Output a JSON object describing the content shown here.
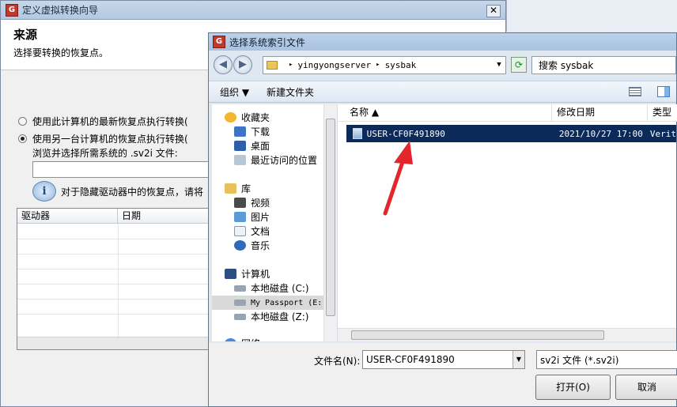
{
  "wizard": {
    "logo_text": "G",
    "title": "定义虚拟转换向导",
    "close_symbol": "✕",
    "header_title": "来源",
    "header_subtitle": "选择要转换的恢复点。",
    "option1": "使用此计算机的最新恢复点执行转换(",
    "option2": "使用另一台计算机的恢复点执行转换(",
    "browse_label": "浏览并选择所需系统的 .sv2i 文件:",
    "info_glyph": "i",
    "info_text": "对于隐藏驱动器中的恢复点，请将",
    "table_headers": [
      "驱动器",
      "日期"
    ]
  },
  "dialog": {
    "logo_text": "G",
    "title": "选择系统索引文件",
    "back_symbol": "◀",
    "forward_symbol": "▶",
    "breadcrumb": [
      "yingyongserver",
      "sysbak"
    ],
    "crumb_separator": "▸",
    "address_dropdown": "▼",
    "refresh_symbol": "⟳",
    "search_placeholder": "搜索 sysbak",
    "toolbar": {
      "organize": "组织 ▼",
      "new_folder": "新建文件夹"
    },
    "nav": {
      "favorites": "收藏夹",
      "downloads": "下载",
      "desktop": "桌面",
      "recent": "最近访问的位置",
      "libraries": "库",
      "videos": "视频",
      "pictures": "图片",
      "documents": "文档",
      "music": "音乐",
      "computer": "计算机",
      "drive_c": "本地磁盘 (C:)",
      "passport": "My Passport (E:",
      "drive_z": "本地磁盘 (Z:)",
      "network": "网络"
    },
    "columns": {
      "name": "名称 ▲",
      "date": "修改日期",
      "type": "类型"
    },
    "file": {
      "name": "USER-CF0F491890",
      "date": "2021/10/27 17:00",
      "type": "Verit"
    },
    "filename_label": "文件名(N):",
    "filename_value": "USER-CF0F491890",
    "filetype_value": "sv2i 文件 (*.sv2i)",
    "open_button": "打开(O)",
    "cancel_button": "取消"
  },
  "colors": {
    "selection": "#0b2a5a",
    "arrow": "#e3262b"
  }
}
